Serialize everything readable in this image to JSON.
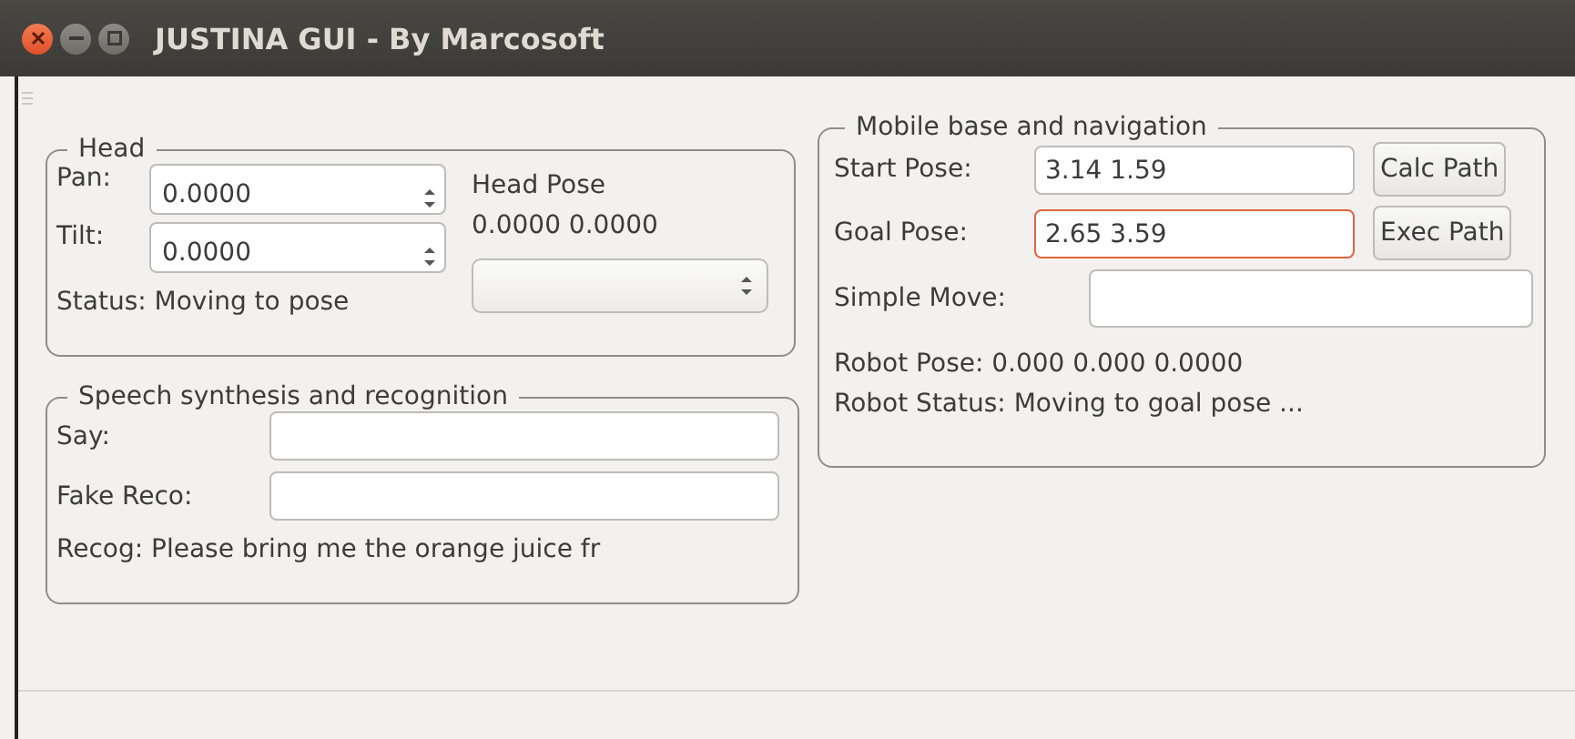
{
  "window": {
    "title": "JUSTINA GUI - By Marcosoft"
  },
  "head": {
    "title": "Head",
    "spinners": [
      {
        "label": "Pan:",
        "value": "0.0000"
      },
      {
        "label": "Tilt:",
        "value": "0.0000"
      }
    ],
    "status": "Status: Moving to pose",
    "pose_label": "Head Pose",
    "pose_values": "0.0000  0.0000"
  },
  "speech": {
    "title": "Speech synthesis and recognition",
    "fields": [
      {
        "label": "Say:"
      },
      {
        "label": "Fake Reco:"
      }
    ],
    "recog": "Recog: Please bring me the orange juice fr"
  },
  "navigation": {
    "title": "Mobile base and navigation",
    "fields": [
      {
        "label": "Start Pose:",
        "value": "3.14 1.59",
        "focused": false,
        "button": "Calc Path"
      },
      {
        "label": "Goal Pose:",
        "value": "2.65 3.59",
        "focused": true,
        "button": "Exec Path"
      },
      {
        "label": "Simple Move:",
        "focused": false
      }
    ],
    "robot_pose": "Robot Pose: 0.000 0.000 0.0000",
    "robot_status": "Robot Status: Moving to goal pose ..."
  }
}
